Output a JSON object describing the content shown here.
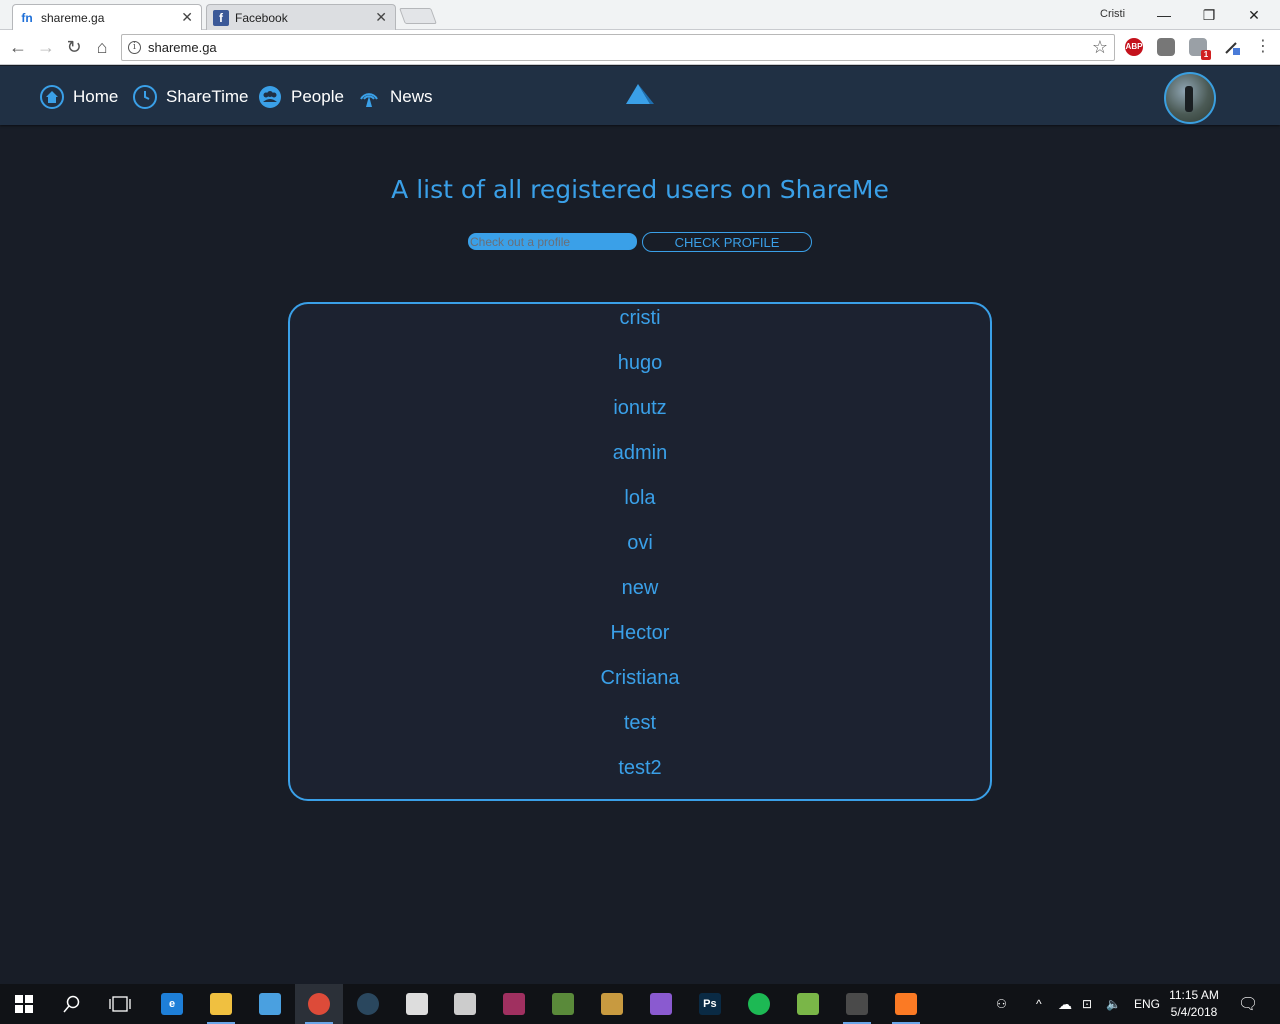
{
  "browser": {
    "tabs": [
      {
        "title": "shareme.ga",
        "favicon": "fn"
      },
      {
        "title": "Facebook",
        "favicon": "f"
      }
    ],
    "profile_name": "Cristi",
    "url": "shareme.ga",
    "extensions": [
      {
        "name": "adblock-icon",
        "label": "ABP",
        "color": "#c4121c"
      },
      {
        "name": "briefcase-icon",
        "label": "",
        "color": "#777777"
      },
      {
        "name": "puzzle-extension-icon",
        "label": "1",
        "color": "#9aa0a6"
      },
      {
        "name": "eyedropper-icon",
        "label": "",
        "color": "#4a7bd8"
      }
    ]
  },
  "site": {
    "nav": [
      {
        "label": "Home",
        "icon": "home-icon"
      },
      {
        "label": "ShareTime",
        "icon": "clock-icon"
      },
      {
        "label": "People",
        "icon": "people-icon"
      },
      {
        "label": "News",
        "icon": "broadcast-icon"
      }
    ],
    "accent": "#3aa0e8"
  },
  "main": {
    "title": "A list of all registered users on ShareMe",
    "search_placeholder": "Check out a profile",
    "check_button": "CHECK PROFILE",
    "users": [
      "cristi",
      "hugo",
      "ionutz",
      "admin",
      "lola",
      "ovi",
      "new",
      "Hector",
      "Cristiana",
      "test",
      "test2"
    ]
  },
  "taskbar": {
    "apps": [
      {
        "name": "start-icon"
      },
      {
        "name": "search-icon"
      },
      {
        "name": "task-view-icon"
      },
      {
        "name": "edge-icon",
        "label": "e",
        "color": "#1e7fd8"
      },
      {
        "name": "file-explorer-icon",
        "label": "",
        "color": "#f0c040"
      },
      {
        "name": "store-icon",
        "label": "",
        "color": "#4aa0e0"
      },
      {
        "name": "chrome-icon",
        "label": "",
        "color": "#dd4b39"
      },
      {
        "name": "steam-icon",
        "label": "",
        "color": "#2a475e"
      },
      {
        "name": "unity-icon",
        "label": "",
        "color": "#dddddd"
      },
      {
        "name": "skyrim-icon",
        "label": "",
        "color": "#cccccc"
      },
      {
        "name": "winrar-icon",
        "label": "",
        "color": "#a03060"
      },
      {
        "name": "minecraft-icon",
        "label": "",
        "color": "#5a8a3a"
      },
      {
        "name": "hearthstone-icon",
        "label": "",
        "color": "#c89a40"
      },
      {
        "name": "visual-studio-icon",
        "label": "",
        "color": "#8a5ad0"
      },
      {
        "name": "photoshop-icon",
        "label": "Ps",
        "color": "#0a2a44"
      },
      {
        "name": "spotify-icon",
        "label": "",
        "color": "#1db954"
      },
      {
        "name": "android-studio-icon",
        "label": "",
        "color": "#7ab648"
      },
      {
        "name": "sublime-icon",
        "label": "",
        "color": "#4a4a4a"
      },
      {
        "name": "xampp-icon",
        "label": "",
        "color": "#fb7a24"
      }
    ],
    "language": "ENG",
    "time": "11:15 AM",
    "date": "5/4/2018"
  }
}
